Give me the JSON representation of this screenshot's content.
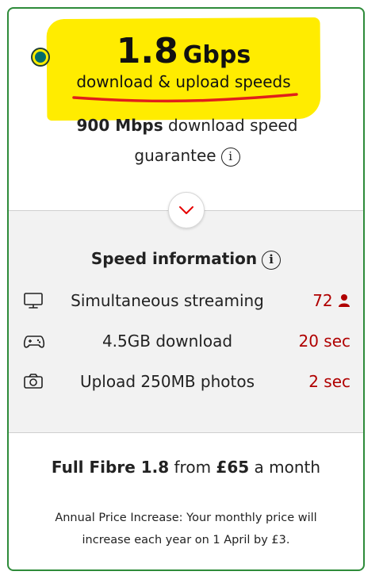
{
  "speed": {
    "value": "1.8",
    "unit": "Gbps",
    "subtitle": "download & upload speeds"
  },
  "guarantee": {
    "bold": "900 Mbps",
    "text_line1": " download speed",
    "text_line2": "guarantee"
  },
  "speed_info": {
    "title": "Speed information",
    "rows": [
      {
        "icon": "tv-icon",
        "label": "Simultaneous streaming",
        "value": "72"
      },
      {
        "icon": "gamepad-icon",
        "label": "4.5GB download",
        "value": "20 sec"
      },
      {
        "icon": "camera-icon",
        "label": "Upload 250MB photos",
        "value": "2 sec"
      }
    ]
  },
  "plan": {
    "name": "Full Fibre 1.8",
    "from": " from ",
    "price": "£65",
    "period": " a month"
  },
  "notice": "Annual Price Increase: Your monthly price will increase each year on 1 April by £3.",
  "colors": {
    "highlight": "#ffec00",
    "border": "#2e8b3a",
    "accent_red": "#b00000",
    "radio_fill": "#006b6b"
  }
}
